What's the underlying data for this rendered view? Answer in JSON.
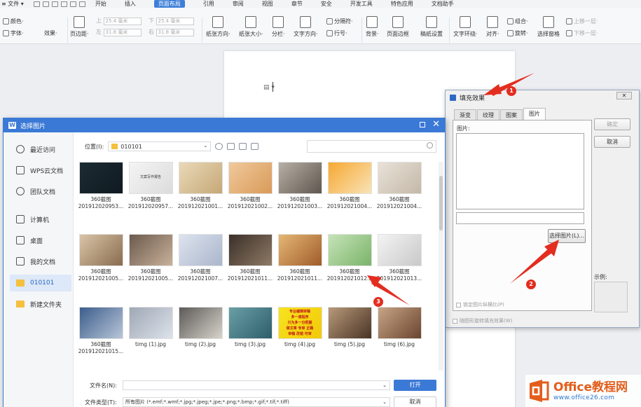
{
  "menubar": {
    "file": "≡ 文件 ▾",
    "tabs": [
      "开始",
      "插入",
      "页面布局",
      "引用",
      "审阅",
      "视图",
      "章节",
      "安全",
      "开发工具",
      "特色应用",
      "文档助手"
    ],
    "active_tab": "页面布局"
  },
  "ribbon": {
    "colors": "颜色·",
    "fonts": "字体·",
    "effects": "效果·",
    "margins": "页边距·",
    "top_label": "上",
    "top_value": "25.4 毫米",
    "bottom_label": "下",
    "bottom_value": "25.4 毫米",
    "left_label": "左",
    "left_value": "31.8 毫米",
    "right_label": "右",
    "right_value": "31.8 毫米",
    "orientation": "纸张方向·",
    "size": "纸张大小·",
    "columns": "分栏·",
    "text_direction": "文字方向·",
    "separator": "分隔符·",
    "line_numbers": "行号·",
    "background": "背景·",
    "page_border": "页面边框",
    "page_setup": "稿纸设置",
    "text_wrap": "文字环绕·",
    "align": "对齐·",
    "group": "组合·",
    "rotate": "旋转·",
    "selection_pane": "选择窗格",
    "bring_forward": "上移一层·",
    "send_backward": "下移一层·"
  },
  "doc": {
    "anchor_icon": "anchor-icon"
  },
  "fill_dialog": {
    "title": "填充效果",
    "close": "✕",
    "tabs": [
      "渐变",
      "纹理",
      "图案",
      "图片"
    ],
    "active_tab": "图片",
    "picture_label": "图片:",
    "select_picture": "选择图片(L)...",
    "lock_ratio": "锁定图片纵横比(P)",
    "rotate_with_shape": "随图形旋转填充效果(W)",
    "ok": "确定",
    "cancel": "取消",
    "example": "示例:"
  },
  "pic_dialog": {
    "title": "选择图片",
    "sidebar": [
      {
        "label": "最近访问",
        "icon": "clock-icon"
      },
      {
        "label": "WPS云文档",
        "icon": "cube-icon"
      },
      {
        "label": "团队文档",
        "icon": "team-icon"
      },
      {
        "label": "计算机",
        "icon": "monitor-icon"
      },
      {
        "label": "桌面",
        "icon": "desktop-icon"
      },
      {
        "label": "我的文档",
        "icon": "document-icon"
      },
      {
        "label": "010101",
        "icon": "folder-icon"
      },
      {
        "label": "新建文件夹",
        "icon": "folder-icon"
      }
    ],
    "active_nav": "010101",
    "location_label": "位置(I):",
    "location_value": "010101",
    "thumbnails": [
      {
        "l1": "360截图",
        "l2": "201912020953..."
      },
      {
        "l1": "360截图",
        "l2": "201912020957..."
      },
      {
        "l1": "360截图",
        "l2": "201912021001..."
      },
      {
        "l1": "360截图",
        "l2": "201912021002..."
      },
      {
        "l1": "360截图",
        "l2": "201912021003..."
      },
      {
        "l1": "360截图",
        "l2": "201912021004..."
      },
      {
        "l1": "360截图",
        "l2": "201912021004..."
      },
      {
        "l1": "360截图",
        "l2": "201912021005..."
      },
      {
        "l1": "360截图",
        "l2": "201912021005..."
      },
      {
        "l1": "360截图",
        "l2": "201912021007..."
      },
      {
        "l1": "360截图",
        "l2": "201912021011..."
      },
      {
        "l1": "360截图",
        "l2": "201912021011..."
      },
      {
        "l1": "360截图",
        "l2": "201912021012..."
      },
      {
        "l1": "360截图",
        "l2": "201912021013..."
      },
      {
        "l1": "360截图",
        "l2": "201912021015..."
      },
      {
        "l1": "timg (1).jpg",
        "l2": ""
      },
      {
        "l1": "timg (2).jpg",
        "l2": ""
      },
      {
        "l1": "timg (3).jpg",
        "l2": ""
      },
      {
        "l1": "timg (4).jpg",
        "l2": ""
      },
      {
        "l1": "timg (5).jpg",
        "l2": ""
      },
      {
        "l1": "timg (6).jpg",
        "l2": ""
      }
    ],
    "thumb2_text": "文案写作报告",
    "thumb19_lines": [
      "专业编辑审稿",
      "多一道程序",
      "只为多一分把握",
      "做文章 专审 正确",
      "审稿 改错 可审"
    ],
    "filename_label": "文件名(N):",
    "filename_value": "",
    "filetype_label": "文件类型(T):",
    "filetype_value": "所有图片 (*.emf;*.wmf;*.jpg;*.jpeg;*.jpe;*.png;*.bmp;*.gif;*.tif;*.tiff)",
    "open": "打开",
    "cancel": "取消"
  },
  "annotations": [
    "1",
    "2",
    "3"
  ],
  "colors": {
    "accent": "#3b79d6",
    "arrow": "#e32d1f",
    "folder": "#f4c03e"
  },
  "watermark": {
    "title": "Office教程网",
    "url": "www.office26.com"
  }
}
